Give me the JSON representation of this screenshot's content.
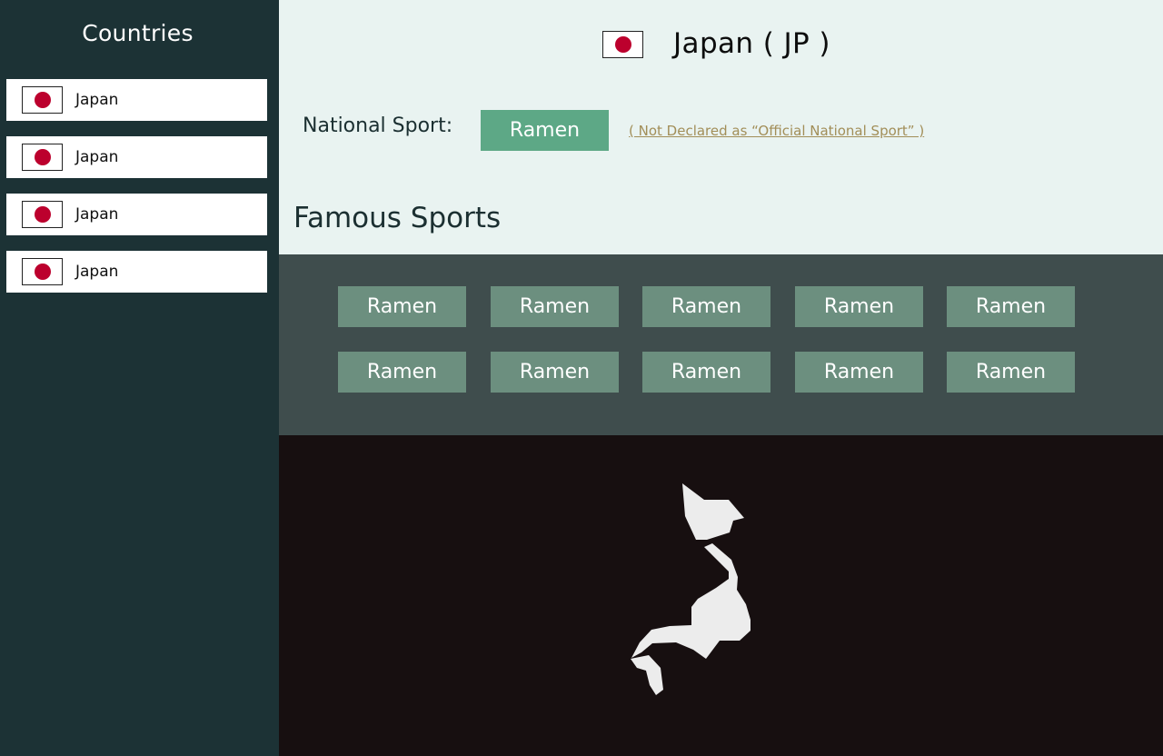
{
  "sidebar": {
    "title": "Countries",
    "items": [
      {
        "flag": "japan-flag",
        "label": "Japan"
      },
      {
        "flag": "japan-flag",
        "label": "Japan"
      },
      {
        "flag": "japan-flag",
        "label": "Japan"
      },
      {
        "flag": "japan-flag",
        "label": "Japan"
      }
    ]
  },
  "header": {
    "flag": "japan-flag",
    "title": "Japan ( JP )"
  },
  "national_sport": {
    "label": "National Sport:",
    "value": "Ramen",
    "note": "( Not Declared as “Official National Sport” )"
  },
  "famous_sports": {
    "title": "Famous Sports",
    "items": [
      "Ramen",
      "Ramen",
      "Ramen",
      "Ramen",
      "Ramen",
      "Ramen",
      "Ramen",
      "Ramen",
      "Ramen",
      "Ramen"
    ]
  },
  "map": {
    "icon": "japan-map",
    "land_color": "#ececec",
    "background_color": "#170f10"
  },
  "colors": {
    "sidebar_bg": "#1c3235",
    "header_bg": "#e9f3f1",
    "national_sport_badge": "#5da886",
    "sport_button": "#6c8f7f",
    "note_link": "#a28e58",
    "flag_red": "#bc002d"
  }
}
